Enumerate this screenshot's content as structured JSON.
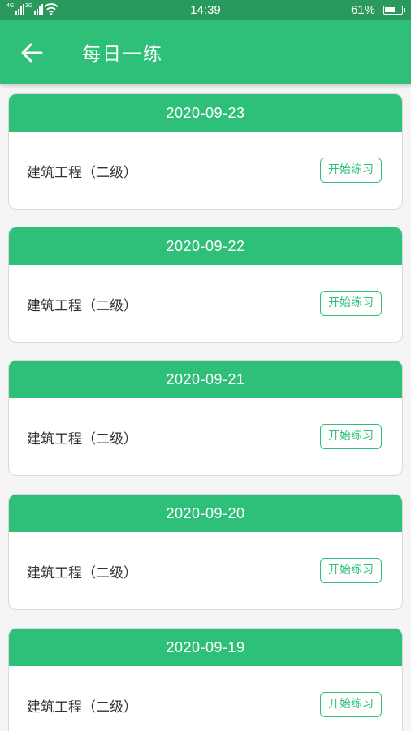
{
  "status_bar": {
    "network_1": "4G",
    "network_2": "3G",
    "time": "14:39",
    "battery": "61%",
    "battery_level": 0.61
  },
  "header": {
    "title": "每日一练",
    "back_icon": "arrow-left-icon"
  },
  "colors": {
    "primary": "#2ec078",
    "status_bar": "#2a9a5c",
    "background": "#f5f5f5"
  },
  "cards": [
    {
      "date": "2020-09-23",
      "subject": "建筑工程（二级）",
      "button": "开始练习"
    },
    {
      "date": "2020-09-22",
      "subject": "建筑工程（二级）",
      "button": "开始练习"
    },
    {
      "date": "2020-09-21",
      "subject": "建筑工程（二级）",
      "button": "开始练习"
    },
    {
      "date": "2020-09-20",
      "subject": "建筑工程（二级）",
      "button": "开始练习"
    },
    {
      "date": "2020-09-19",
      "subject": "建筑工程（二级）",
      "button": "开始练习"
    }
  ]
}
